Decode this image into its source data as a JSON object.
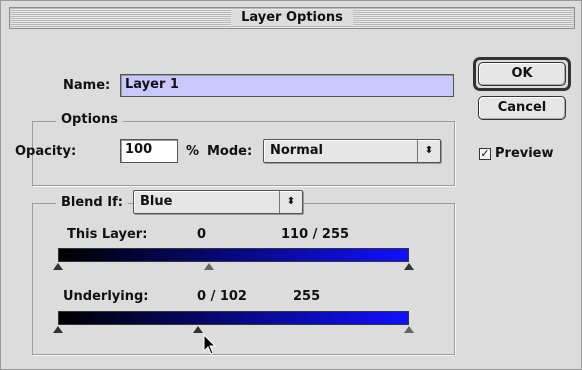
{
  "window": {
    "title": "Layer Options"
  },
  "name_field": {
    "label": "Name:",
    "value": "Layer 1"
  },
  "buttons": {
    "ok": "OK",
    "cancel": "Cancel"
  },
  "preview": {
    "label": "Preview",
    "checked": true
  },
  "options": {
    "title": "Options",
    "opacity_label": "Opacity:",
    "opacity_value": "100",
    "opacity_unit": "%",
    "mode_label": "Mode:",
    "mode_value": "Normal"
  },
  "blend_if": {
    "label": "Blend If:",
    "channel": "Blue",
    "this_layer": {
      "label": "This Layer:",
      "left": "0",
      "right": "110 / 255",
      "black_point": 0,
      "white_low": 110,
      "white_high": 255
    },
    "underlying": {
      "label": "Underlying:",
      "left": "0 / 102",
      "right": "255",
      "black_low": 0,
      "black_high": 102,
      "white_point": 255
    }
  },
  "colors": {
    "ramp_start": "#000000",
    "ramp_end": "#1010ff",
    "field_highlight": "#c8c8ff"
  }
}
